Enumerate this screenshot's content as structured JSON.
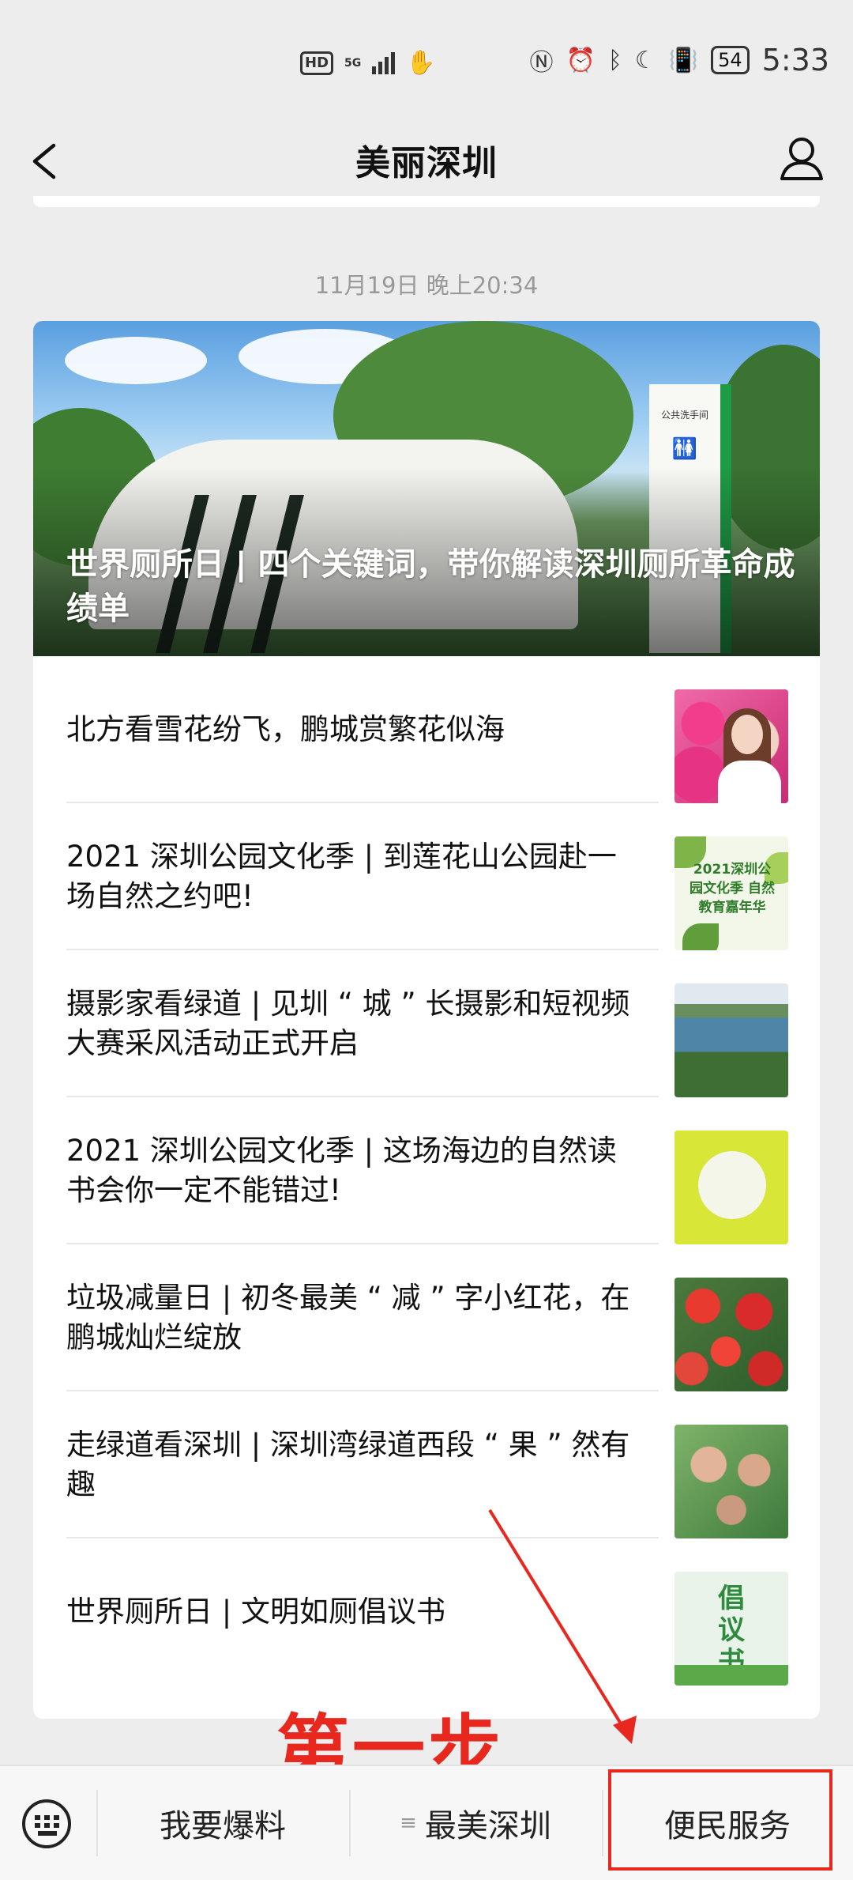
{
  "status_bar": {
    "hd": "HD",
    "network": "5G",
    "battery": "54",
    "time": "5:33"
  },
  "nav": {
    "title": "美丽深圳"
  },
  "article_group": {
    "timestamp": "11月19日 晚上20:34",
    "cover_title": "世界厕所日 | 四个关键词，带你解读深圳厕所革命成绩单",
    "cover_sign_text": "公共洗手间",
    "items": [
      {
        "title": "北方看雪花纷飞，鹏城赏繁花似海",
        "thumb": "flowers-photo"
      },
      {
        "title": "2021 深圳公园文化季 | 到莲花山公园赴一场自然之约吧!",
        "thumb": "nature-education-poster",
        "thumb_text": "2021深圳公园文化季 自然教育嘉年华"
      },
      {
        "title": "摄影家看绿道 | 见圳 “ 城 ” 长摄影和短视频大赛采风活动正式开启",
        "thumb": "lake-photo"
      },
      {
        "title": "2021 深圳公园文化季 | 这场海边的自然读书会你一定不能错过!",
        "thumb": "reading-illustration"
      },
      {
        "title": "垃圾减量日 | 初冬最美 “ 减 ” 字小红花，在鹏城灿烂绽放",
        "thumb": "red-flowers-photo"
      },
      {
        "title": "走绿道看深圳 | 深圳湾绿道西段 “ 果 ” 然有趣",
        "thumb": "hands-photo"
      },
      {
        "title": "世界厕所日 | 文明如厕倡议书",
        "thumb": "proposal-poster",
        "thumb_text": "倡议书"
      }
    ]
  },
  "annotation": {
    "step_label": "第一步",
    "color": "#e8281f"
  },
  "bottom_menu": {
    "items": [
      {
        "label": "我要爆料"
      },
      {
        "label": "最美深圳",
        "has_submenu_icon": true
      },
      {
        "label": "便民服务",
        "highlighted": true
      }
    ]
  }
}
